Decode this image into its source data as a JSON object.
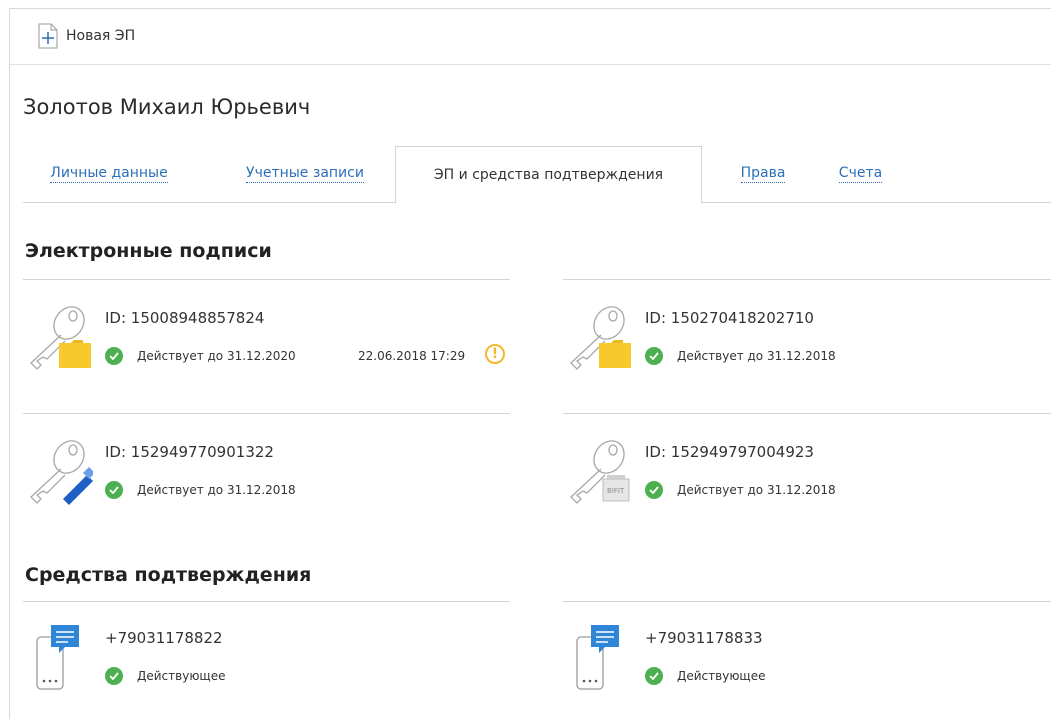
{
  "toolbar": {
    "new_signature_label": "Новая ЭП"
  },
  "person_name": "Золотов Михаил Юрьевич",
  "tabs": [
    {
      "label": "Личные данные",
      "active": false
    },
    {
      "label": "Учетные записи",
      "active": false
    },
    {
      "label": "ЭП и средства подтверждения",
      "active": true
    },
    {
      "label": "Права",
      "active": false
    },
    {
      "label": "Счета",
      "active": false
    }
  ],
  "signatures_section": {
    "title": "Электронные подписи",
    "items": [
      {
        "id": "ID: 15008948857824",
        "status": "Действует до 31.12.2020",
        "date": "22.06.2018 17:29",
        "warning": true,
        "icon": "key-folder-icon"
      },
      {
        "id": "ID: 150270418202710",
        "status": "Действует до 31.12.2018",
        "icon": "key-folder-icon"
      },
      {
        "id": "ID: 152949770901322",
        "status": "Действует до 31.12.2018",
        "icon": "key-usb-token-icon"
      },
      {
        "id": "ID: 152949797004923",
        "status": "Действует до 31.12.2018",
        "icon": "key-bifit-token-icon",
        "token_label": "BIFIT"
      }
    ]
  },
  "confirmations_section": {
    "title": "Средства подтверждения",
    "items": [
      {
        "phone": "+79031178822",
        "status": "Действующее",
        "icon": "sms-phone-icon"
      },
      {
        "phone": "+79031178833",
        "status": "Действующее",
        "icon": "sms-phone-icon"
      }
    ]
  },
  "colors": {
    "link": "#2d6fb8",
    "ok": "#4caf50",
    "warning": "#f5b72e",
    "folder": "#f7c92a",
    "sms": "#2f86d6"
  }
}
